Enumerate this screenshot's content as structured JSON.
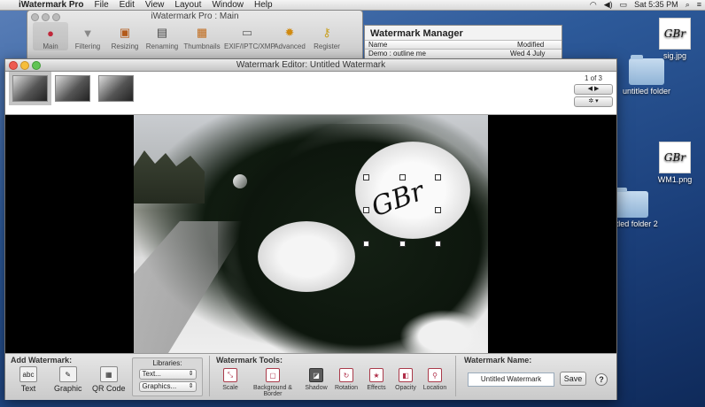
{
  "menubar": {
    "app_name": "iWatermark Pro",
    "items": [
      "File",
      "Edit",
      "View",
      "Layout",
      "Window",
      "Help"
    ],
    "clock": "Sat 5:35 PM"
  },
  "desktop": {
    "icons": [
      {
        "label": "sig.jpg",
        "thumb_text": "GBr"
      },
      {
        "label": "untitled folder"
      },
      {
        "label": "WM1.png",
        "thumb_text": "GBr"
      },
      {
        "label": "untitled folder 2"
      }
    ]
  },
  "main_window": {
    "title": "iWatermark Pro : Main",
    "tools": [
      "Main",
      "Filtering",
      "Resizing",
      "Renaming",
      "Thumbnails",
      "EXIF/IPTC/XMP",
      "Advanced",
      "Register"
    ]
  },
  "manager": {
    "title": "Watermark Manager",
    "col_name": "Name",
    "col_modified": "Modified",
    "row_name": "Demo : outline me",
    "row_date": "Wed 4 July"
  },
  "editor": {
    "title": "Watermark Editor: Untitled Watermark",
    "page_count": "1 of 3",
    "signature_text": "GBr"
  },
  "bottom": {
    "add_title": "Add Watermark:",
    "add_items": [
      "Text",
      "Graphic",
      "QR Code"
    ],
    "libraries_title": "Libraries:",
    "lib_text": "Text...",
    "lib_graphics": "Graphics...",
    "tools_title": "Watermark Tools:",
    "tools": [
      "Scale",
      "Background & Border",
      "Shadow",
      "Rotation",
      "Effects",
      "Opacity",
      "Location"
    ],
    "name_title": "Watermark Name:",
    "name_value": "Untitled Watermark",
    "save_label": "Save",
    "help_label": "?"
  }
}
